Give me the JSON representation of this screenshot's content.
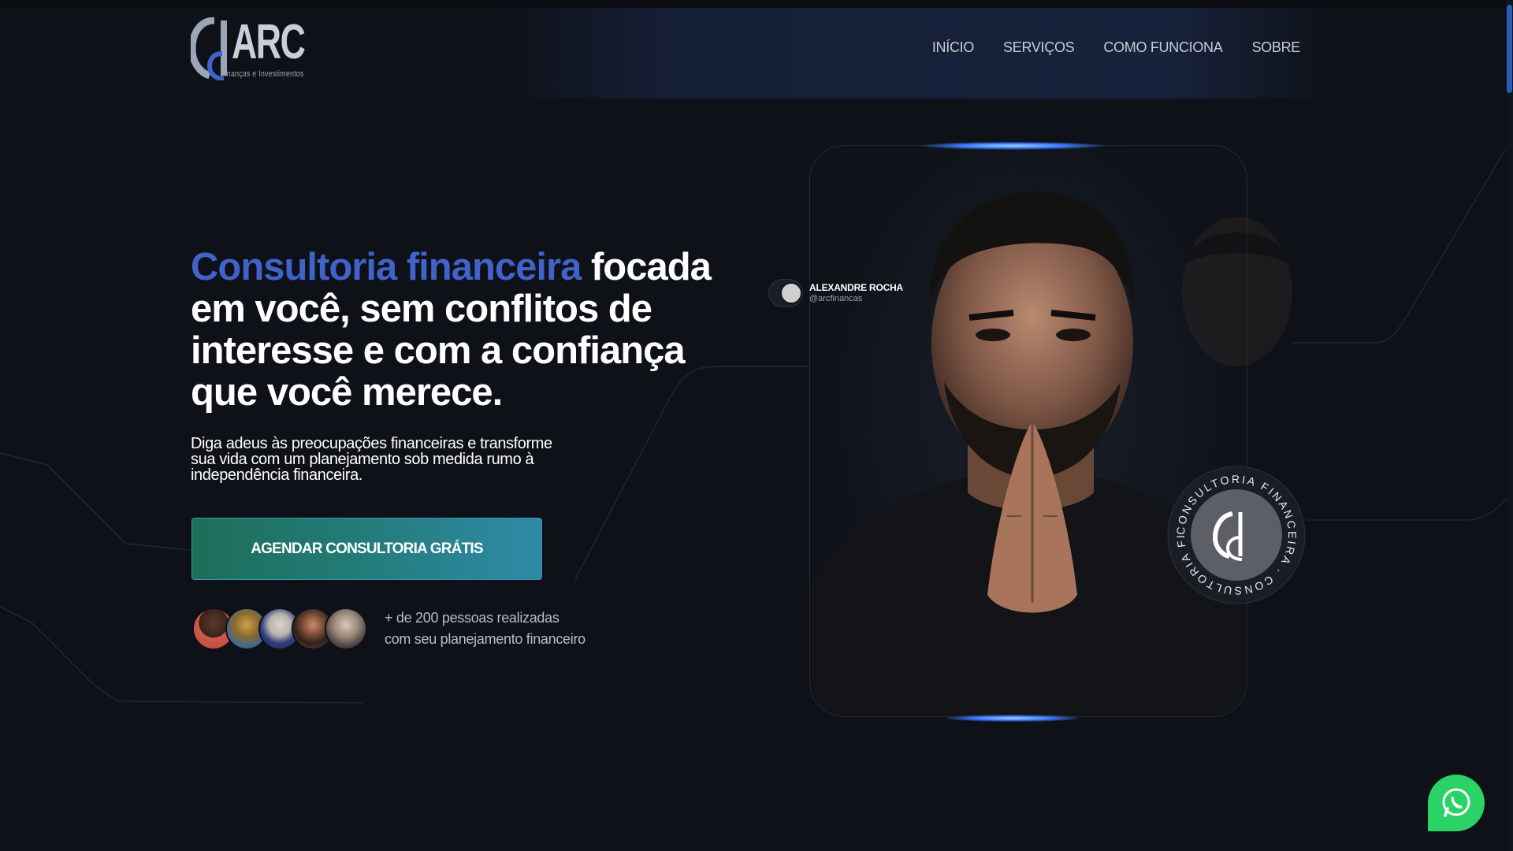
{
  "brand": {
    "name": "ARC",
    "tagline": "Finanças e Investimentos"
  },
  "nav": {
    "items": [
      "INÍCIO",
      "SERVIÇOS",
      "COMO FUNCIONA",
      "SOBRE"
    ]
  },
  "hero": {
    "title_accent": "Consultoria financeira",
    "title_rest": " focada em você, sem conflitos de interesse e com a confiança que você merece.",
    "subtitle": "Diga adeus às preocupações financeiras e transforme sua vida com um planejamento sob medida rumo à independência financeira.",
    "cta_label": "AGENDAR CONSULTORIA GRÁTIS",
    "social_proof_line1": "+ de 200 pessoas realizadas",
    "social_proof_line2": "com seu planejamento financeiro"
  },
  "profile": {
    "name": "ALEXANDRE ROCHA",
    "handle": "@arcfinancas"
  },
  "badge": {
    "ring_text": "CONSULTORIA FINANCEIRA · CONSULTORIA FINANCEIRA ·"
  },
  "colors": {
    "background": "#0e1118",
    "accent_blue": "#3f63c9",
    "cta_start": "#1c6f58",
    "cta_end": "#2f8aa8",
    "whatsapp": "#2bd366"
  },
  "icons": {
    "whatsapp": "whatsapp-icon"
  }
}
